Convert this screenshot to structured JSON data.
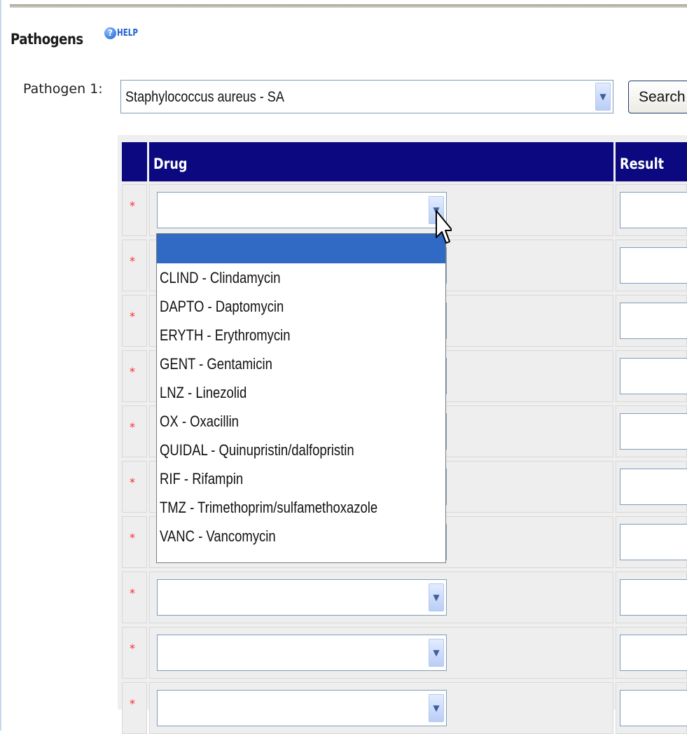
{
  "section": {
    "title": "Pathogens",
    "help_label": "HELP",
    "help_icon": "question-circle-icon"
  },
  "pathogen": {
    "label": "Pathogen 1:",
    "selected": "Staphylococcus aureus - SA",
    "search_label": "Search"
  },
  "table": {
    "headers": {
      "drug": "Drug",
      "result": "Result"
    },
    "header_color": "#0b0880",
    "required_marker": "*",
    "required_color": "#ff2a2a",
    "rows": [
      {
        "drug": "",
        "result": ""
      },
      {
        "drug": "",
        "result": ""
      },
      {
        "drug": "",
        "result": ""
      },
      {
        "drug": "",
        "result": ""
      },
      {
        "drug": "",
        "result": ""
      },
      {
        "drug": "",
        "result": ""
      },
      {
        "drug": "",
        "result": ""
      },
      {
        "drug": "",
        "result": ""
      },
      {
        "drug": "",
        "result": ""
      },
      {
        "drug": "",
        "result": ""
      }
    ]
  },
  "drug_dropdown": {
    "open": true,
    "highlight_color": "#316ac5",
    "options": [
      "",
      "CLIND - Clindamycin",
      "DAPTO - Daptomycin",
      "ERYTH - Erythromycin",
      "GENT - Gentamicin",
      "LNZ - Linezolid",
      "OX - Oxacillin",
      "QUIDAL - Quinupristin/dalfopristin",
      "RIF - Rifampin",
      "TMZ - Trimethoprim/sulfamethoxazole",
      "VANC - Vancomycin"
    ],
    "selected_index": 0
  },
  "icons": {
    "select_arrow": "chevron-down-icon",
    "pointer": "mouse-pointer-icon"
  }
}
